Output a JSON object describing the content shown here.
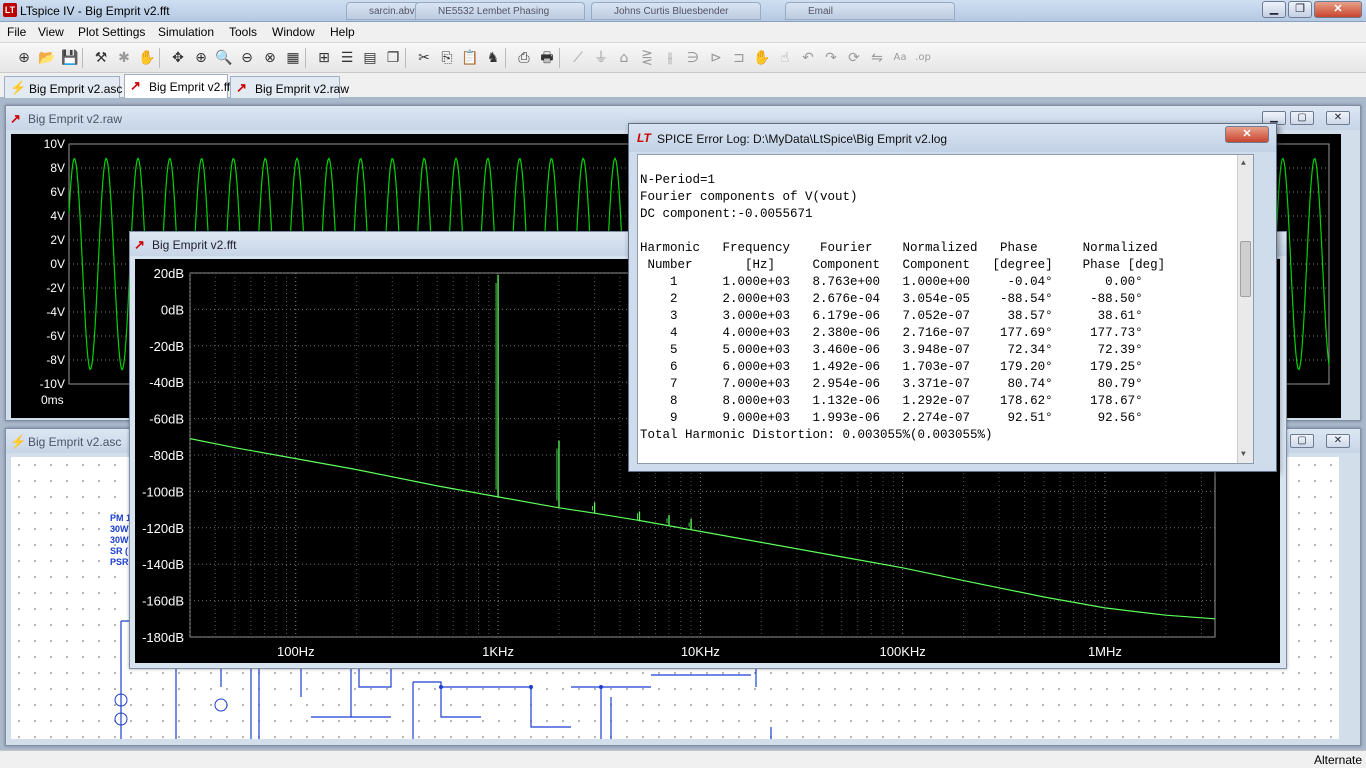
{
  "window": {
    "title": "LTspice IV - Big Emprit v2.fft",
    "bg_tabs": [
      "",
      "sarcin.abv",
      "NE5532 Lembet Phasing",
      "Johns Curtis Bluesbender",
      "Email"
    ]
  },
  "menu": [
    "File",
    "View",
    "Plot Settings",
    "Simulation",
    "Tools",
    "Window",
    "Help"
  ],
  "toolbar_icons": [
    "new-schematic-icon",
    "open-icon",
    "save-icon",
    "control-panel-icon",
    "run-icon",
    "halt-icon",
    "pan-icon",
    "zoom-in-icon",
    "zoom-area-icon",
    "zoom-out-icon",
    "zoom-fit-icon",
    "autorange-icon",
    "grid-icon",
    "tile-horizontal-icon",
    "tile-vertical-icon",
    "cascade-icon",
    "cut-icon",
    "copy-icon",
    "paste-icon",
    "find-icon",
    "print-preview-icon",
    "print-icon",
    "wire-icon",
    "ground-icon",
    "label-icon",
    "resistor-icon",
    "capacitor-icon",
    "inductor-icon",
    "diode-icon",
    "component-icon",
    "move-icon",
    "drag-icon",
    "undo-icon",
    "redo-icon",
    "rotate-icon",
    "mirror-icon",
    "text-icon",
    "spice-directive-icon"
  ],
  "doc_tabs": [
    {
      "label": "Big Emprit v2.asc",
      "icon": "schematic-icon"
    },
    {
      "label": "Big Emprit v2.fft",
      "icon": "waveform-icon",
      "active": true
    },
    {
      "label": "Big Emprit v2.raw",
      "icon": "waveform-icon"
    }
  ],
  "raw_window": {
    "title": "Big Emprit v2.raw",
    "y_ticks": [
      "10V",
      "8V",
      "6V",
      "4V",
      "2V",
      "0V",
      "-2V",
      "-4V",
      "-6V",
      "-8V",
      "-10V"
    ],
    "x_label": "0ms",
    "trace_color": "#00d400"
  },
  "asc_window": {
    "title": "Big Emprit v2.asc",
    "notes": [
      "PM 1",
      "30W",
      "30W",
      "SR (",
      "PSR"
    ]
  },
  "fft_window": {
    "title": "Big Emprit v2.fft",
    "trace_color": "#5cff5c"
  },
  "chart_data": {
    "type": "line",
    "title": "",
    "xlabel": "",
    "ylabel": "",
    "x_scale": "log",
    "x_ticks": [
      "100Hz",
      "1KHz",
      "10KHz",
      "100KHz",
      "1MHz"
    ],
    "y_ticks": [
      "20dB",
      "0dB",
      "-20dB",
      "-40dB",
      "-60dB",
      "-80dB",
      "-100dB",
      "-120dB",
      "-140dB",
      "-160dB",
      "-180dB"
    ],
    "xlim_hz": [
      30,
      3500000
    ],
    "ylim_db": [
      -180,
      20
    ],
    "grid": true,
    "series": [
      {
        "x_hz": [
          30,
          50,
          100,
          200,
          500,
          1000,
          2000,
          3000,
          5000,
          10000,
          20000,
          50000,
          100000,
          200000,
          500000,
          1000000,
          2000000,
          3500000
        ],
        "y_db": [
          -71,
          -76,
          -82,
          -88,
          -97,
          -103,
          -109,
          -112,
          -116,
          -122,
          -128,
          -136,
          -142,
          -149,
          -158,
          -164,
          -168,
          -170
        ]
      }
    ],
    "peaks": [
      {
        "x_hz": 1000,
        "y_db": 19
      },
      {
        "x_hz": 2000,
        "y_db": -72
      },
      {
        "x_hz": 3000,
        "y_db": -106
      },
      {
        "x_hz": 5000,
        "y_db": -111
      },
      {
        "x_hz": 7000,
        "y_db": -113
      },
      {
        "x_hz": 9000,
        "y_db": -115
      }
    ]
  },
  "log_window": {
    "title": "SPICE Error Log: D:\\MyData\\LtSpice\\Big Emprit v2.log",
    "lines": [
      "",
      "N-Period=1",
      "Fourier components of V(vout)",
      "DC component:-0.0055671",
      "",
      "Harmonic   Frequency    Fourier    Normalized   Phase      Normalized",
      " Number       [Hz]     Component   Component   [degree]    Phase [deg]",
      "    1      1.000e+03   8.763e+00   1.000e+00     -0.04°       0.00°",
      "    2      2.000e+03   2.676e-04   3.054e-05    -88.54°     -88.50°",
      "    3      3.000e+03   6.179e-06   7.052e-07     38.57°      38.61°",
      "    4      4.000e+03   2.380e-06   2.716e-07    177.69°     177.73°",
      "    5      5.000e+03   3.460e-06   3.948e-07     72.34°      72.39°",
      "    6      6.000e+03   1.492e-06   1.703e-07    179.20°     179.25°",
      "    7      7.000e+03   2.954e-06   3.371e-07     80.74°      80.79°",
      "    8      8.000e+03   1.132e-06   1.292e-07    178.62°     178.67°",
      "    9      9.000e+03   1.993e-06   2.274e-07     92.51°      92.56°",
      "Total Harmonic Distortion: 0.003055%(0.003055%)"
    ]
  },
  "status": "Alternate"
}
